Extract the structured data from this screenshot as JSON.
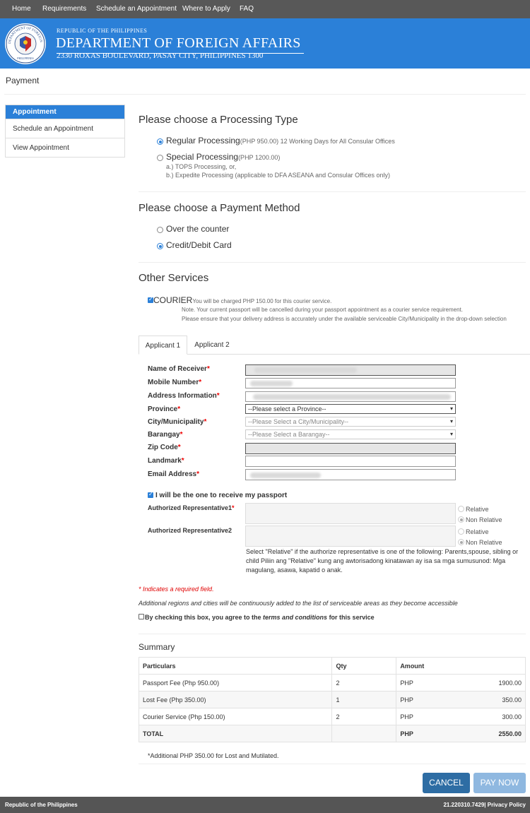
{
  "topnav": [
    "Home",
    "Requirements",
    "Schedule an Appointment",
    "Where to Apply",
    "FAQ"
  ],
  "banner": {
    "republic": "REPUBLIC OF THE PHILIPPINES",
    "department": "DEPARTMENT OF FOREIGN AFFAIRS",
    "address": "2330 ROXAS BOULEVARD, PASAY CITY, PHILIPPINES 1300",
    "seal_text": "DEPARTMENT OF FOREIGN AFFAIRS",
    "seal_bottom": "PHILIPPINES"
  },
  "page_title": "Payment",
  "sidebar": {
    "heading": "Appointment",
    "items": [
      "Schedule an Appointment",
      "View Appointment"
    ]
  },
  "processing": {
    "heading": "Please choose a Processing Type",
    "regular_label": "Regular Processing",
    "regular_detail": "(PHP 950.00) 12 Working Days for All Consular Offices",
    "special_label": "Special Processing",
    "special_price": "(PHP 1200.00)",
    "special_line1": "a.) TOPS Processing, or,",
    "special_line2": "b.) Expedite Processing (applicable to DFA ASEANA and Consular Offices only)",
    "selected": "regular"
  },
  "payment": {
    "heading": "Please choose a Payment Method",
    "options": [
      "Over the counter",
      "Credit/Debit Card"
    ],
    "selected": "Credit/Debit Card"
  },
  "other": {
    "heading": "Other Services",
    "courier_label": "COURIER",
    "courier_charge": "You will be charged PHP 150.00 for this courier service.",
    "note1": "Note. Your current passport will be cancelled during your passport appointment as a courier service requirement.",
    "note2": "Please ensure that your delivery address is accurately under the available serviceable City/Municipality in the drop-down selection",
    "courier_checked": true
  },
  "tabs": [
    "Applicant 1",
    "Applicant 2"
  ],
  "form": {
    "name_label": "Name of Receiver",
    "mobile_label": "Mobile Number",
    "address_label": "Address Information",
    "province_label": "Province",
    "province_value": "--Please select a Province--",
    "city_label": "City/Municipality",
    "city_value": "--Please Select a City/Municipality--",
    "barangay_label": "Barangay",
    "barangay_value": "--Please Select a Barangay--",
    "zip_label": "Zip Code",
    "landmark_label": "Landmark",
    "email_label": "Email Address",
    "required_mark": "*",
    "self_receive": "I will be the one to receive my passport",
    "self_receive_checked": true,
    "rep1_label": "Authorized Representative1",
    "rep2_label": "Authorized Representative2",
    "relative": "Relative",
    "non_relative": "Non Relative",
    "relative_note": "Select \"Relative\" if the authorize representative is one of the following: Parents,spouse, sibling or child Piliin ang \"Relative\" kung ang awtorisadong kinatawan ay isa sa mga sumusunod: Mga magulang, asawa, kapatid o anak."
  },
  "required_note": "* Indicates a required field.",
  "regions_note": "Additional regions and cities will be continuously added to the list of serviceable areas as they become accessible",
  "agree": {
    "prefix": "By checking this box, you agree to the ",
    "link": "terms and conditions",
    "suffix": " for this service"
  },
  "summary": {
    "title": "Summary",
    "headers": [
      "Particulars",
      "Qty",
      "Amount"
    ],
    "rows": [
      {
        "particular": "Passport Fee (Php 950.00)",
        "qty": "2",
        "currency": "PHP",
        "amount": "1900.00"
      },
      {
        "particular": "Lost Fee (Php 350.00)",
        "qty": "1",
        "currency": "PHP",
        "amount": "350.00"
      },
      {
        "particular": "Courier Service (Php 150.00)",
        "qty": "2",
        "currency": "PHP",
        "amount": "300.00"
      }
    ],
    "total_label": "TOTAL",
    "total_currency": "PHP",
    "total_amount": "2550.00",
    "footnote": "*Additional PHP 350.00 for Lost and Mutilated."
  },
  "buttons": {
    "cancel": "CANCEL",
    "pay": "PAY NOW"
  },
  "footer": {
    "left": "Republic of the Philippines",
    "right": "21.220310.7429| Privacy Policy"
  },
  "colors": {
    "brand_blue": "#2b80d8",
    "nav_grey": "#585858",
    "cancel_blue": "#2e6da4",
    "pay_disabled": "#8fb8e0",
    "required_red": "#e00000"
  }
}
